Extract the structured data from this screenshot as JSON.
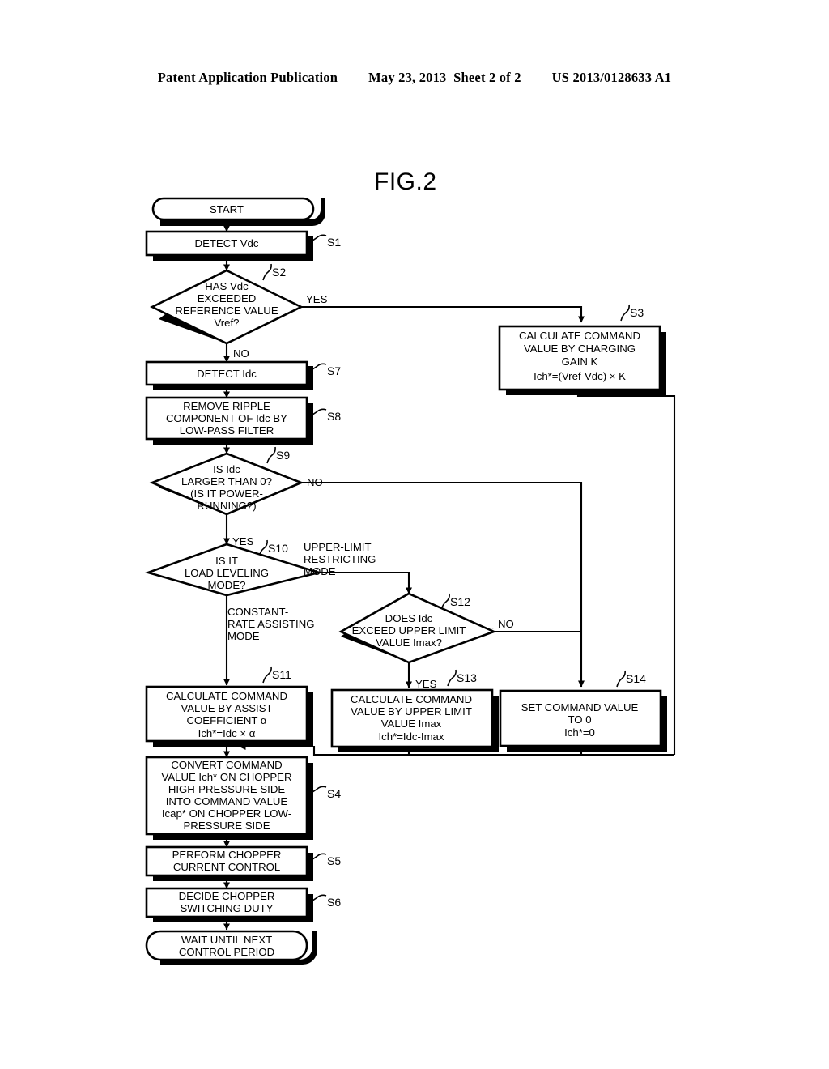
{
  "header": {
    "publication": "Patent Application Publication",
    "date_sheet": "May 23, 2013  Sheet 2 of 2",
    "patent_number": "US 2013/0128633 A1"
  },
  "figure": {
    "title": "FIG.2",
    "type": "flowchart"
  },
  "nodes": {
    "start": {
      "id": "start",
      "shape": "terminator",
      "text": [
        "START"
      ]
    },
    "s1": {
      "id": "S1",
      "shape": "process",
      "text": [
        "DETECT Vdc"
      ]
    },
    "s2": {
      "id": "S2",
      "shape": "decision",
      "text": [
        "HAS Vdc",
        "EXCEEDED",
        "REFERENCE VALUE",
        "Vref?"
      ]
    },
    "s3": {
      "id": "S3",
      "shape": "process",
      "text": [
        "CALCULATE COMMAND",
        "VALUE BY CHARGING",
        "GAIN K",
        "Ich*=(Vref-Vdc) × K"
      ]
    },
    "s7": {
      "id": "S7",
      "shape": "process",
      "text": [
        "DETECT Idc"
      ]
    },
    "s8": {
      "id": "S8",
      "shape": "process",
      "text": [
        "REMOVE RIPPLE",
        "COMPONENT OF Idc BY",
        "LOW-PASS FILTER"
      ]
    },
    "s9": {
      "id": "S9",
      "shape": "decision",
      "text": [
        "IS Idc",
        "LARGER THAN 0?",
        "(IS IT POWER-",
        "RUNNING?)"
      ]
    },
    "s10": {
      "id": "S10",
      "shape": "decision",
      "text": [
        "IS IT",
        "LOAD LEVELING",
        "MODE?"
      ]
    },
    "s12": {
      "id": "S12",
      "shape": "decision",
      "text": [
        "DOES Idc",
        "EXCEED UPPER LIMIT",
        "VALUE Imax?"
      ]
    },
    "s11": {
      "id": "S11",
      "shape": "process",
      "text": [
        "CALCULATE COMMAND",
        "VALUE BY ASSIST",
        "COEFFICIENT α",
        "Ich*=Idc × α"
      ]
    },
    "s13": {
      "id": "S13",
      "shape": "process",
      "text": [
        "CALCULATE COMMAND",
        "VALUE BY UPPER LIMIT",
        "VALUE Imax",
        "Ich*=Idc-Imax"
      ]
    },
    "s14": {
      "id": "S14",
      "shape": "process",
      "text": [
        "SET COMMAND VALUE",
        "TO 0",
        "Ich*=0"
      ]
    },
    "s4": {
      "id": "S4",
      "shape": "process",
      "text": [
        "CONVERT COMMAND",
        "VALUE Ich* ON CHOPPER",
        "HIGH-PRESSURE SIDE",
        "INTO COMMAND VALUE",
        "Icap* ON CHOPPER LOW-",
        "PRESSURE SIDE"
      ]
    },
    "s5": {
      "id": "S5",
      "shape": "process",
      "text": [
        "PERFORM CHOPPER",
        "CURRENT CONTROL"
      ]
    },
    "s6": {
      "id": "S6",
      "shape": "process",
      "text": [
        "DECIDE CHOPPER",
        "SWITCHING DUTY"
      ]
    },
    "end": {
      "id": "end",
      "shape": "terminator",
      "text": [
        "WAIT UNTIL NEXT",
        "CONTROL PERIOD"
      ]
    }
  },
  "edge_labels": {
    "s2_yes": "YES",
    "s2_no": "NO",
    "s9_no": "NO",
    "s9_yes": "YES",
    "s10_upper": [
      "UPPER-LIMIT",
      "RESTRICTING",
      "MODE"
    ],
    "s10_constant": [
      "CONSTANT-",
      "RATE ASSISTING",
      "MODE"
    ],
    "s12_no": "NO",
    "s12_yes": "YES"
  },
  "step_tags": {
    "s1": "S1",
    "s2": "S2",
    "s3": "S3",
    "s4": "S4",
    "s5": "S5",
    "s6": "S6",
    "s7": "S7",
    "s8": "S8",
    "s9": "S9",
    "s10": "S10",
    "s11": "S11",
    "s12": "S12",
    "s13": "S13",
    "s14": "S14"
  },
  "colors": {
    "ink": "#000000",
    "paper": "#ffffff"
  }
}
